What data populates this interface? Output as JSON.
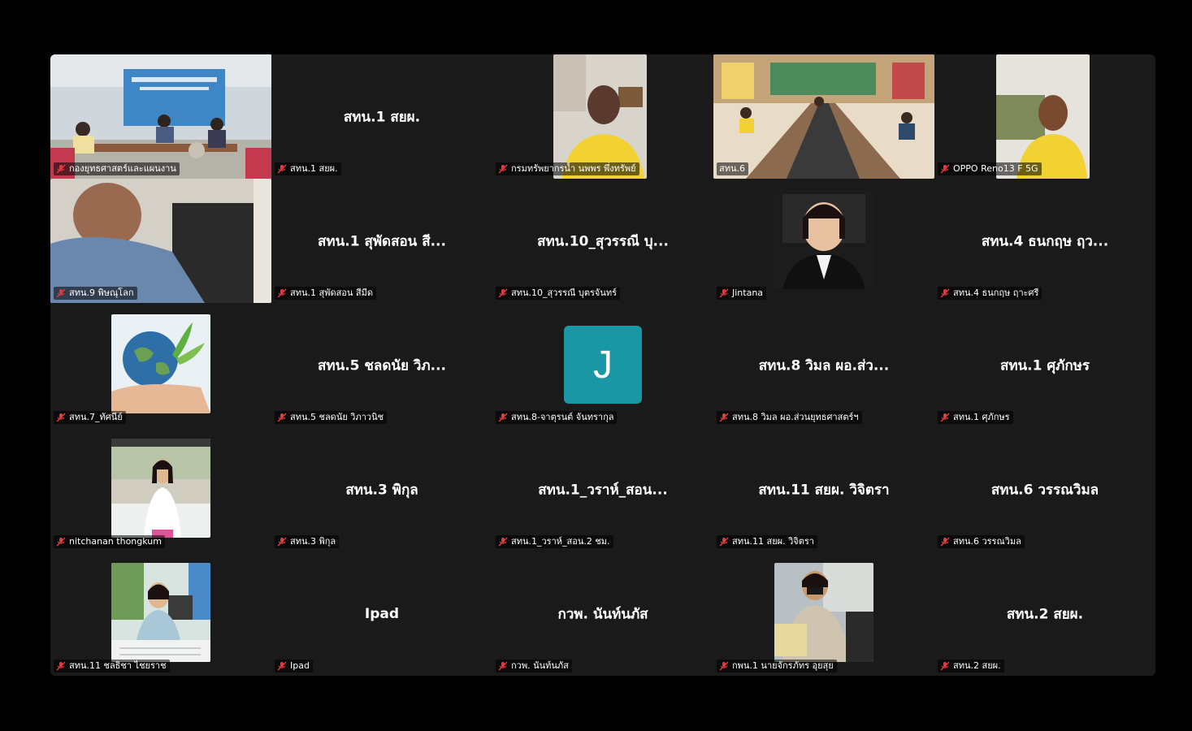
{
  "tiles": [
    {
      "label": "กองยุทธศาสตร์และแผนงาน",
      "type": "video",
      "active": true
    },
    {
      "label": "สทน.1 สยผ.",
      "name": "สทน.1 สยผ.",
      "type": "name"
    },
    {
      "label": "กรมทรัพยากรน้ำ นพพร พึ่งทรัพย์",
      "type": "video"
    },
    {
      "label": "สทน.6",
      "type": "video"
    },
    {
      "label": "OPPO Reno13 F 5G",
      "type": "video"
    },
    {
      "label": "สทน.9 พิษณุโลก",
      "type": "video"
    },
    {
      "label": "สทน.1 สุพัดสอน สีมีด",
      "name": "สทน.1 สุพัดสอน สี...",
      "type": "name"
    },
    {
      "label": "สทน.10_สุวรรณี บุตรจันทร์",
      "name": "สทน.10_สุวรรณี บุ...",
      "type": "name"
    },
    {
      "label": "Jintana",
      "type": "video"
    },
    {
      "label": "สทน.4 ธนกฤษ ฤาะศรี",
      "name": "สทน.4 ธนกฤษ ฤว...",
      "type": "name"
    },
    {
      "label": "สทน.7_ทัศนีย์",
      "type": "image"
    },
    {
      "label": "สทน.5 ชลดนัย วิภาวนิช",
      "name": "สทน.5 ชลดนัย วิภ...",
      "type": "name"
    },
    {
      "label": "สทน.8-จาตุรนต์ จันทรากุล",
      "avatar": "J",
      "type": "avatar"
    },
    {
      "label": "สทน.8 วิมล ผอ.ส่วนยุทธศาสตร์ฯ",
      "name": "สทน.8 วิมล ผอ.ส่ว...",
      "type": "name"
    },
    {
      "label": "สทน.1 ศุภักษร",
      "name": "สทน.1 ศุภักษร",
      "type": "name"
    },
    {
      "label": "nitchanan thongkum",
      "type": "image"
    },
    {
      "label": "สทน.3 พิกุล",
      "name": "สทน.3 พิกุล",
      "type": "name"
    },
    {
      "label": "สทน.1_วราห์_สอน.2 ชม.",
      "name": "สทน.1_วราห์_สอน...",
      "type": "name"
    },
    {
      "label": "สทน.11 สยผ. วิจิตรา",
      "name": "สทน.11 สยผ. วิจิตรา",
      "type": "name"
    },
    {
      "label": "สทน.6 วรรณวิมล",
      "name": "สทน.6 วรรณวิมล",
      "type": "name"
    },
    {
      "label": "สทน.11 ชลธิชา ไชยราช",
      "type": "image"
    },
    {
      "label": "Ipad",
      "name": "Ipad",
      "type": "name"
    },
    {
      "label": "กวพ. นันท์นภัส",
      "name": "กวพ. นันท์นภัส",
      "type": "name"
    },
    {
      "label": "กพน.1 นายจักรภัทร อุยสุย",
      "type": "image"
    },
    {
      "label": "สทน.2 สยผ.",
      "name": "สทน.2 สยผ.",
      "type": "name"
    }
  ],
  "colors": {
    "tile_bg": "#1a1a1a",
    "active_border": "#3fbf6f",
    "mic_muted": "#e03c3c",
    "avatar_bg": "#1a97a4"
  }
}
